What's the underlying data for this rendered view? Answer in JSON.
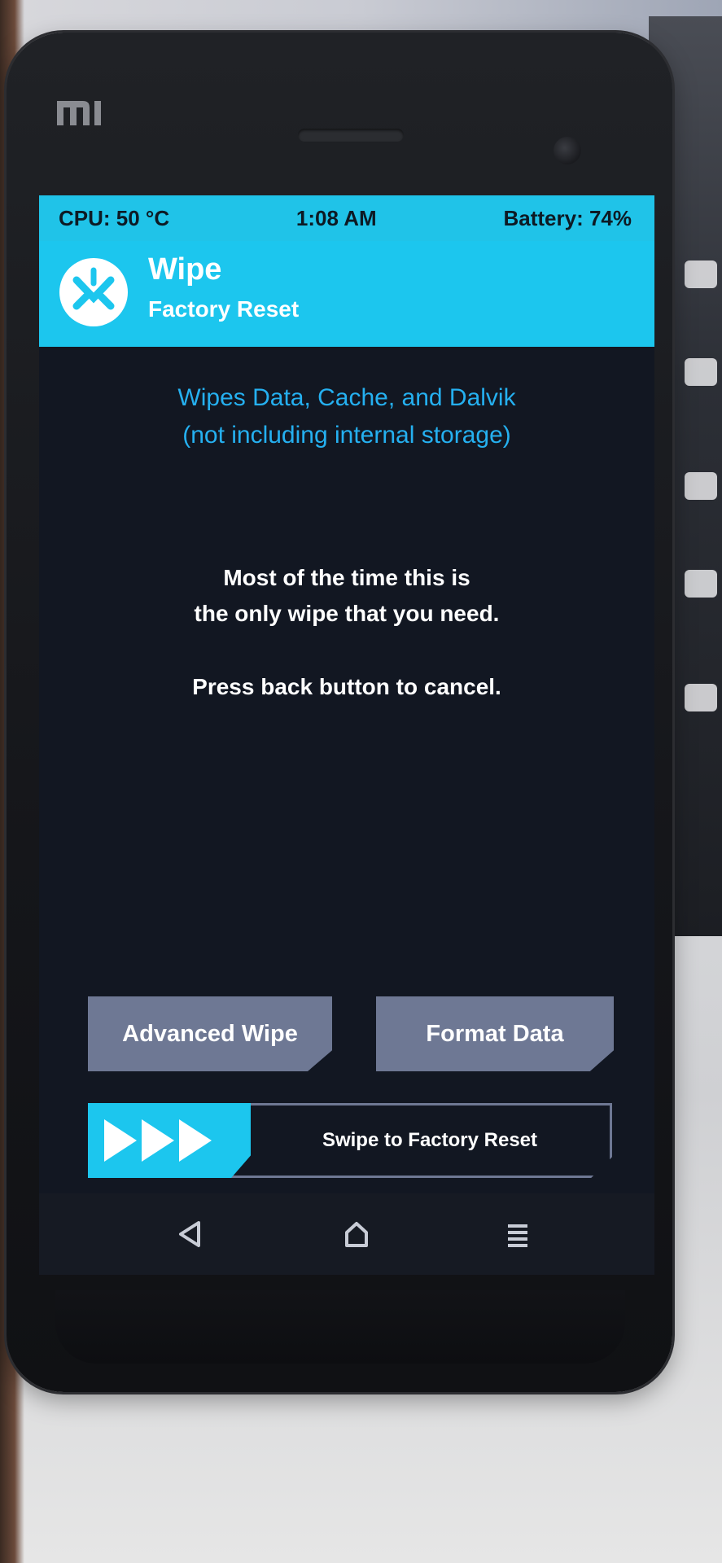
{
  "status_bar": {
    "cpu": "CPU: 50 °C",
    "time": "1:08 AM",
    "battery": "Battery: 74%"
  },
  "header": {
    "title": "Wipe",
    "subtitle": "Factory Reset"
  },
  "description": {
    "line1": "Wipes Data, Cache, and Dalvik",
    "line2": "(not including internal storage)"
  },
  "info": {
    "line1": "Most of the time this is",
    "line2": "the only wipe that you need.",
    "line3": "Press back button to cancel."
  },
  "buttons": {
    "advanced_wipe": "Advanced Wipe",
    "format_data": "Format Data"
  },
  "swipe": {
    "label": "Swipe to Factory Reset"
  },
  "nav": {
    "back_icon": "back-triangle-icon",
    "home_icon": "home-icon",
    "menu_icon": "menu-icon"
  },
  "colors": {
    "accent": "#1cc6ee",
    "description_text": "#25b0f0",
    "button_bg": "#6e7894",
    "screen_bg": "#121722"
  }
}
